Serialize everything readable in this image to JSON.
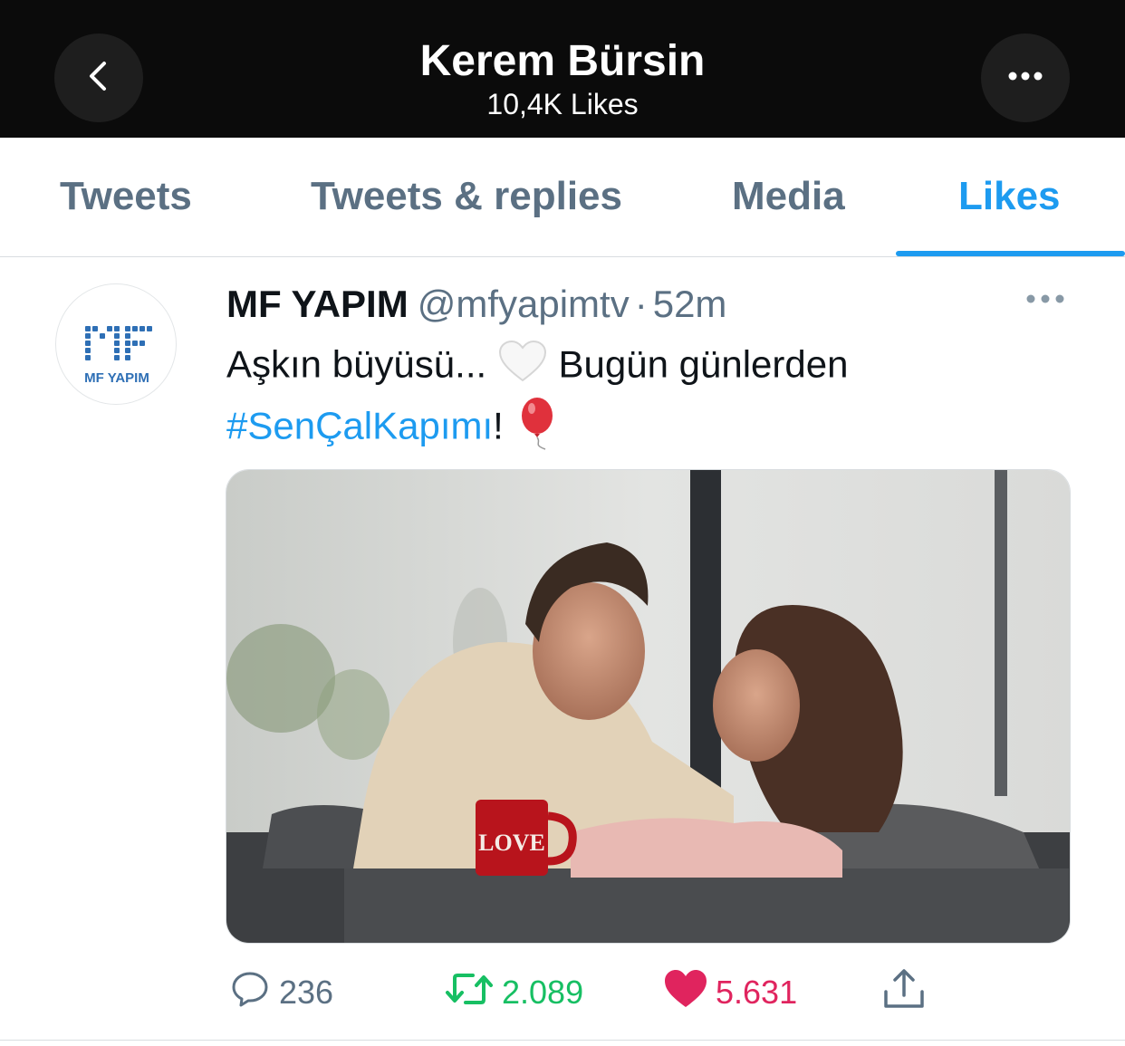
{
  "header": {
    "title": "Kerem Bürsin",
    "subtitle": "10,4K Likes"
  },
  "tabs": [
    {
      "label": "Tweets"
    },
    {
      "label": "Tweets & replies"
    },
    {
      "label": "Media"
    },
    {
      "label": "Likes",
      "active": true
    }
  ],
  "tweet": {
    "author_name": "MF YAPIM",
    "author_handle": "@mfyapimtv",
    "separator": "·",
    "time": "52m",
    "text_part1": "Aşkın büyüsü...",
    "text_part2": "Bugün günlerden",
    "hashtag": "#SenÇalKapımı",
    "text_end": "!",
    "avatar_logo_text": "MF YAPIM",
    "media_mug_text": "LOVE",
    "stats": {
      "replies": "236",
      "retweets": "2.089",
      "likes": "5.631"
    }
  },
  "colors": {
    "accent": "#1d9bf0",
    "secondary_text": "#5b7083",
    "retweet": "#17bf63",
    "like": "#e0245e",
    "header_bg": "#0b0b0b"
  },
  "icons": [
    "chevron-left-icon",
    "more-horizontal-icon",
    "reply-icon",
    "retweet-icon",
    "heart-icon",
    "share-icon",
    "white-heart-emoji",
    "balloon-emoji"
  ]
}
